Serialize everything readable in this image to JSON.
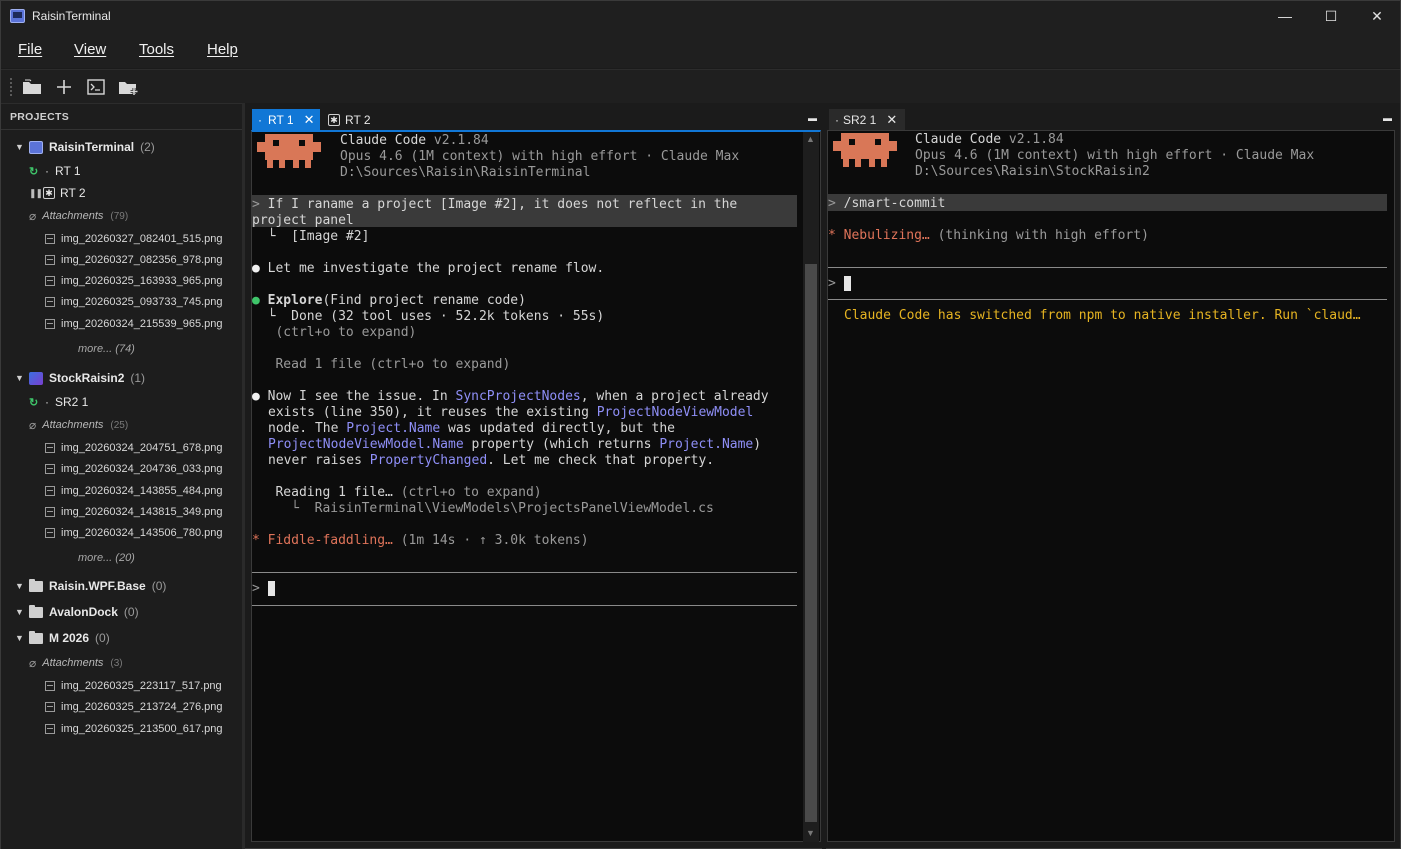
{
  "window": {
    "title": "RaisinTerminal",
    "minimize": "—",
    "maximize": "☐",
    "close": "✕"
  },
  "menu": [
    {
      "label": "File"
    },
    {
      "label": "View"
    },
    {
      "label": "Tools"
    },
    {
      "label": "Help"
    }
  ],
  "toolbar": {
    "icons": [
      "open-folder-icon",
      "add-icon",
      "terminal-icon",
      "new-folder-icon"
    ]
  },
  "sidebar": {
    "header": "PROJECTS",
    "projects": [
      {
        "name": "RaisinTerminal",
        "count": "(2)",
        "sessions": [
          {
            "label": "RT 1",
            "status": "running"
          },
          {
            "label": "RT 2",
            "status": "paused"
          }
        ],
        "attachments_label": "Attachments",
        "attachments_count": "(79)",
        "files": [
          "img_20260327_082401_515.png",
          "img_20260327_082356_978.png",
          "img_20260325_163933_965.png",
          "img_20260325_093733_745.png",
          "img_20260324_215539_965.png"
        ],
        "more": "more... (74)"
      },
      {
        "name": "StockRaisin2",
        "count": "(1)",
        "sessions": [
          {
            "label": "SR2 1",
            "status": "running"
          }
        ],
        "attachments_label": "Attachments",
        "attachments_count": "(25)",
        "files": [
          "img_20260324_204751_678.png",
          "img_20260324_204736_033.png",
          "img_20260324_143855_484.png",
          "img_20260324_143815_349.png",
          "img_20260324_143506_780.png"
        ],
        "more": "more... (20)"
      },
      {
        "name": "Raisin.WPF.Base",
        "count": "(0)"
      },
      {
        "name": "AvalonDock",
        "count": "(0)"
      },
      {
        "name": "M 2026",
        "count": "(0)",
        "attachments_label": "Attachments",
        "attachments_count": "(3)",
        "files": [
          "img_20260325_223117_517.png",
          "img_20260325_213724_276.png",
          "img_20260325_213500_617.png"
        ]
      }
    ]
  },
  "left_pane": {
    "tabs": [
      {
        "label": "RT 1",
        "prefix": "·",
        "close": "✕"
      },
      {
        "label": "RT 2",
        "prefix": "✱"
      }
    ],
    "header": {
      "name": "Claude Code",
      "version": "v2.1.84",
      "model": "Opus 4.6 (1M context) with high effort · Claude Max",
      "path": "D:\\Sources\\Raisin\\RaisinTerminal"
    },
    "prompt_line1": "If I raname a project [Image #2], it does not reflect in the",
    "prompt_line2": "project panel",
    "image_ref": "  └  [Image #2]",
    "msg1": "Let me investigate the project rename flow.",
    "explore_label": "Explore",
    "explore_arg": "(Find project rename code)",
    "explore_done": "  └  Done (32 tool uses · 52.2k tokens · 55s)",
    "explore_expand": "   (ctrl+o to expand)",
    "read_files": "   Read 1 file (ctrl+o to expand)",
    "analysis": {
      "l1a": "Now I see the issue. In ",
      "l1b": "SyncProjectNodes",
      "l1c": ", when a project already",
      "l2a": "exists (line 350), it reuses the existing ",
      "l2b": "ProjectNodeViewModel",
      "l3a": "node. The ",
      "l3b": "Project.Name",
      "l3c": " was updated directly, but the",
      "l4a": "ProjectNodeViewModel.Name",
      "l4b": " property (which returns ",
      "l4c": "Project.Name",
      "l4d": ")",
      "l5a": "never raises ",
      "l5b": "PropertyChanged",
      "l5c": ". Let me check that property."
    },
    "reading": "   Reading 1 file… ",
    "reading_hint": "(ctrl+o to expand)",
    "reading_path": "     └  RaisinTerminal\\ViewModels\\ProjectsPanelViewModel.cs",
    "spinner_word": "Fiddle-faddling…",
    "spinner_meta": " (1m 14s · ↑ 3.0k tokens)",
    "input_prompt": ">"
  },
  "right_pane": {
    "tabs": [
      {
        "label": "SR2 1",
        "prefix": "·",
        "close": "✕"
      }
    ],
    "header": {
      "name": "Claude Code",
      "version": "v2.1.84",
      "model": "Opus 4.6 (1M context) with high effort · Claude Max",
      "path": "D:\\Sources\\Raisin\\StockRaisin2"
    },
    "command": "/smart-commit",
    "status_word": "Nebulizing…",
    "status_meta": " (thinking with high effort)",
    "input_prompt": ">",
    "notice": "Claude Code has switched from npm to native installer. Run `claud…"
  },
  "colors": {
    "accent": "#1177d6",
    "claude_orange": "#d97757",
    "link_purple": "#8f8ff7",
    "running_green": "#3fc56a",
    "notice_yellow": "#e6b422"
  }
}
